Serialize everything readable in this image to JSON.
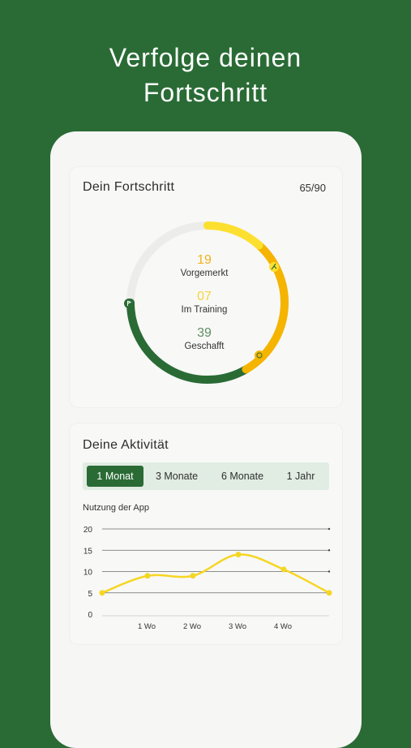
{
  "headline": {
    "line1": "Verfolge deinen",
    "line2": "Fortschritt"
  },
  "progress": {
    "title": "Dein Fortschritt",
    "counter": "65/90",
    "stats": [
      {
        "value": "19",
        "label": "Vorgemerkt",
        "color": "#f0b21a"
      },
      {
        "value": "07",
        "label": "Im Training",
        "color": "#f5d63d"
      },
      {
        "value": "39",
        "label": "Geschafft",
        "color": "#5e8f62"
      }
    ],
    "ring": {
      "total": 90,
      "done": 39,
      "training": 7,
      "marked": 19,
      "colors": {
        "done": "#2a6b35",
        "marked": "#f5b400",
        "training": "#fde02f",
        "track": "#ececea"
      }
    }
  },
  "activity": {
    "title": "Deine Aktivität",
    "tabs": [
      {
        "label": "1 Monat",
        "active": true
      },
      {
        "label": "3 Monate",
        "active": false
      },
      {
        "label": "6 Monate",
        "active": false
      },
      {
        "label": "1 Jahr",
        "active": false
      }
    ]
  },
  "chart_data": {
    "type": "line",
    "title": "Nutzung der App",
    "categories": [
      "1 Wo",
      "2 Wo",
      "3 Wo",
      "4 Wo"
    ],
    "y_ticks": [
      0,
      5,
      10,
      15,
      20
    ],
    "ylim": [
      0,
      20
    ],
    "series": [
      {
        "x": [
          0,
          1,
          2,
          3,
          4,
          5
        ],
        "values": [
          5,
          9,
          9,
          14,
          10.5,
          5
        ],
        "color": "#f5d623"
      }
    ],
    "grid": true
  }
}
